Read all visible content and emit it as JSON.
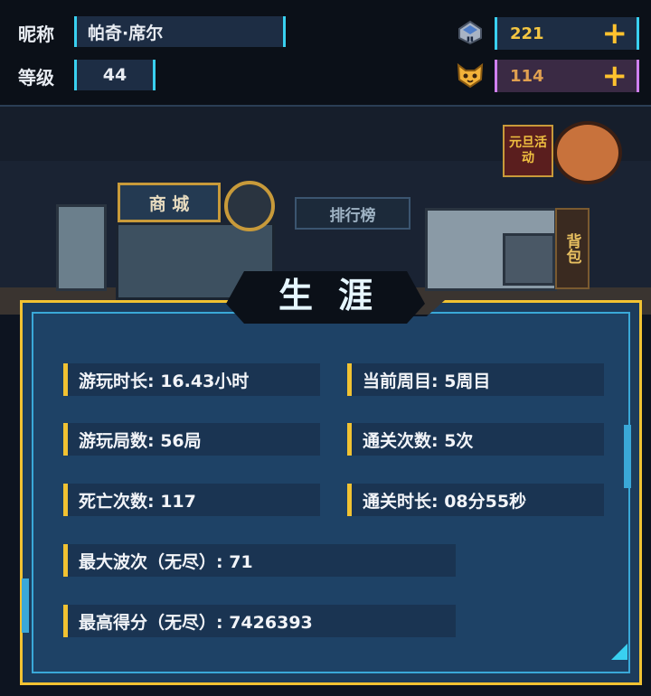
{
  "header": {
    "nickname_label": "昵称",
    "nickname_value": "帕奇·席尔",
    "level_label": "等级",
    "level_value": "44",
    "currency1": {
      "icon": "gem-box-icon",
      "value": "221",
      "plus": "+",
      "color": "#f4c642"
    },
    "currency2": {
      "icon": "cat-face-icon",
      "value": "114",
      "plus": "+",
      "color": "#e0a050"
    }
  },
  "scene": {
    "shop_sign": "商 城",
    "leaderboard_sign": "排行榜",
    "backpack_sign": "背包",
    "event_sign": "元旦活动"
  },
  "panel": {
    "title": "生涯",
    "stats": [
      {
        "label": "游玩时长: 16.43小时"
      },
      {
        "label": "当前周目: 5周目"
      },
      {
        "label": "游玩局数: 56局"
      },
      {
        "label": "通关次数: 5次"
      },
      {
        "label": "死亡次数: 117"
      },
      {
        "label": "通关时长: 08分55秒"
      },
      {
        "label": "最大波次（无尽）: 71"
      },
      {
        "label": "最高得分（无尽）: 7426393"
      }
    ]
  },
  "colors": {
    "accent_yellow": "#f1c232",
    "accent_cyan": "#39d0f0",
    "panel_blue": "#1e4266"
  }
}
